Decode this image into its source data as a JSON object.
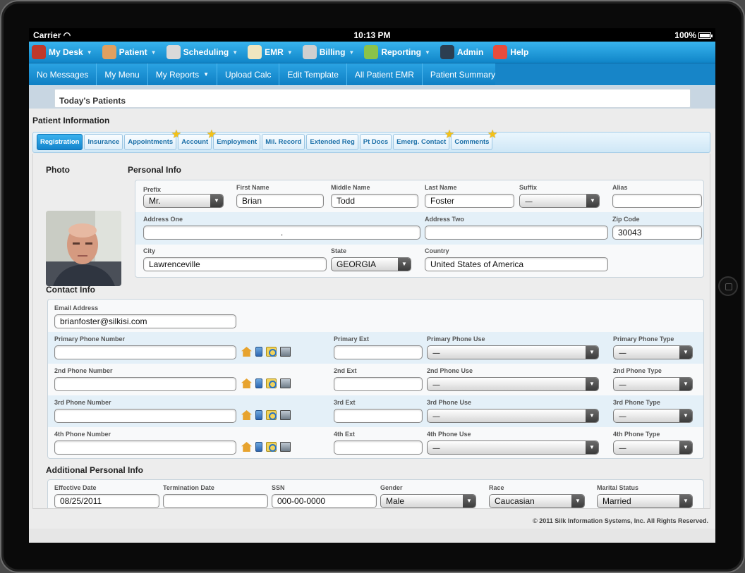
{
  "status": {
    "carrier": "Carrier",
    "time": "10:13 PM",
    "battery": "100%"
  },
  "menu": [
    {
      "label": "My Desk",
      "icon": "desk-icon",
      "color": "#c0392b"
    },
    {
      "label": "Patient",
      "icon": "patient-icon",
      "color": "#e0a060"
    },
    {
      "label": "Scheduling",
      "icon": "calendar-icon",
      "color": "#d9d9d9"
    },
    {
      "label": "EMR",
      "icon": "clipboard-icon",
      "color": "#f0e6c0"
    },
    {
      "label": "Billing",
      "icon": "cash-register-icon",
      "color": "#cfcfcf"
    },
    {
      "label": "Reporting",
      "icon": "chart-icon",
      "color": "#8bc34a"
    },
    {
      "label": "Admin",
      "icon": "admin-icon",
      "color": "#2c3e50"
    },
    {
      "label": "Help",
      "icon": "lifebuoy-icon",
      "color": "#e74c3c"
    }
  ],
  "submenu": [
    "No Messages",
    "My Menu",
    "My Reports",
    "Upload Calc",
    "Edit Template",
    "All Patient EMR",
    "Patient Summary"
  ],
  "today": "Today's Patients",
  "patient_info_title": "Patient Information",
  "tabs": [
    {
      "label": "Registration",
      "active": true,
      "star": false
    },
    {
      "label": "Insurance",
      "active": false,
      "star": false
    },
    {
      "label": "Appointments",
      "active": false,
      "star": true
    },
    {
      "label": "Account",
      "active": false,
      "star": true
    },
    {
      "label": "Employment",
      "active": false,
      "star": false
    },
    {
      "label": "Mil. Record",
      "active": false,
      "star": false
    },
    {
      "label": "Extended Reg",
      "active": false,
      "star": false
    },
    {
      "label": "Pt Docs",
      "active": false,
      "star": false
    },
    {
      "label": "Emerg. Contact",
      "active": false,
      "star": true
    },
    {
      "label": "Comments",
      "active": false,
      "star": true
    }
  ],
  "photo_title": "Photo",
  "personal": {
    "title": "Personal Info",
    "prefix_label": "Prefix",
    "prefix": "Mr.",
    "first_label": "First Name",
    "first": "Brian",
    "middle_label": "Middle Name",
    "middle": "Todd",
    "last_label": "Last Name",
    "last": "Foster",
    "suffix_label": "Suffix",
    "suffix": "-----",
    "alias_label": "Alias",
    "alias": "",
    "addr1_label": "Address One",
    "addr1": ".",
    "addr2_label": "Address Two",
    "addr2": "",
    "zip_label": "Zip Code",
    "zip": "30043",
    "city_label": "City",
    "city": "Lawrenceville",
    "state_label": "State",
    "state": "GEORGIA",
    "country_label": "Country",
    "country": "United States of America"
  },
  "contact": {
    "title": "Contact Info",
    "email_label": "Email Address",
    "email": "brianfoster@silkisi.com",
    "phones": [
      {
        "num_label": "Primary Phone Number",
        "num": "",
        "ext_label": "Primary Ext",
        "ext": "",
        "use_label": "Primary Phone Use",
        "use": "-----",
        "type_label": "Primary Phone Type",
        "type": "-----"
      },
      {
        "num_label": "2nd Phone Number",
        "num": "",
        "ext_label": "2nd Ext",
        "ext": "",
        "use_label": "2nd Phone Use",
        "use": "-----",
        "type_label": "2nd Phone Type",
        "type": "-----"
      },
      {
        "num_label": "3rd Phone Number",
        "num": "",
        "ext_label": "3rd Ext",
        "ext": "",
        "use_label": "3rd Phone Use",
        "use": "-----",
        "type_label": "3rd Phone Type",
        "type": "-----"
      },
      {
        "num_label": "4th Phone Number",
        "num": "",
        "ext_label": "4th Ext",
        "ext": "",
        "use_label": "4th Phone Use",
        "use": "-----",
        "type_label": "4th Phone Type",
        "type": "-----"
      }
    ]
  },
  "additional": {
    "title": "Additional Personal Info",
    "eff_label": "Effective Date",
    "eff": "08/25/2011",
    "term_label": "Termination Date",
    "term": "",
    "ssn_label": "SSN",
    "ssn": "000-00-0000",
    "gender_label": "Gender",
    "gender": "Male",
    "race_label": "Race",
    "race": "Caucasian",
    "marital_label": "Marital Status",
    "marital": "Married"
  },
  "copyright": "© 2011 Silk Information Systems, Inc.  All Rights Reserved."
}
